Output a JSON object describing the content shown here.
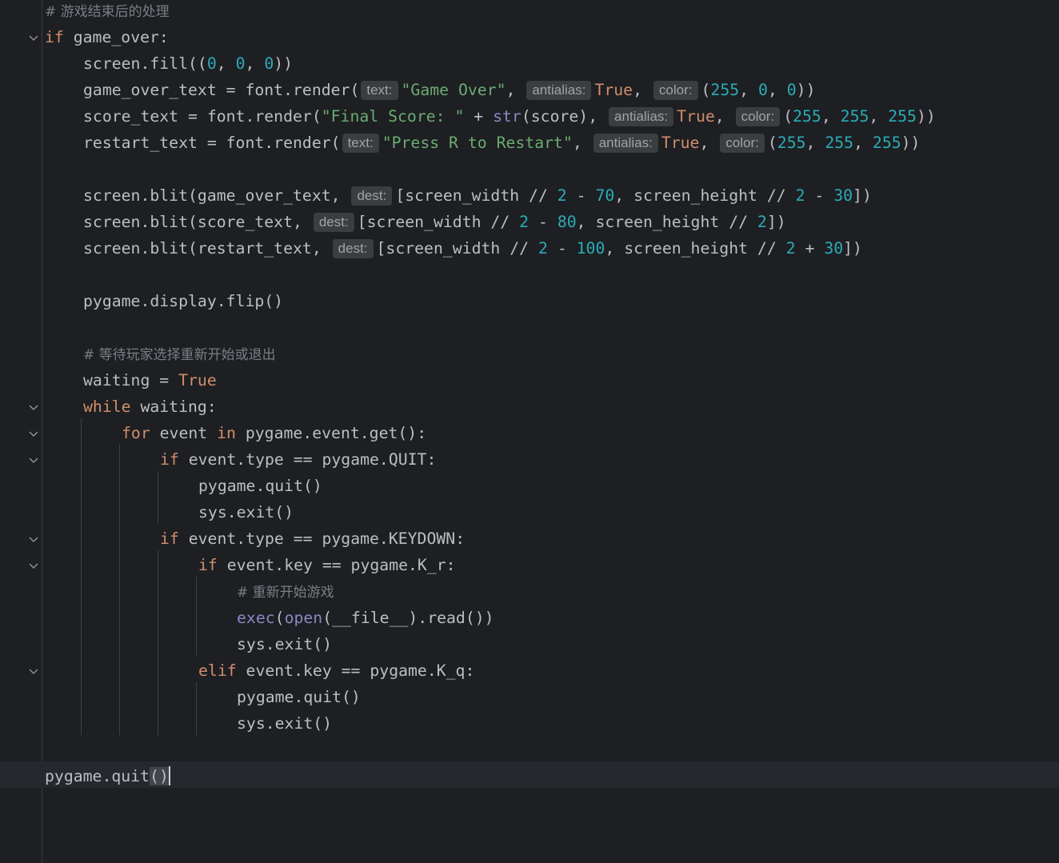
{
  "editor": {
    "theme_colors": {
      "background": "#1e1f22",
      "keyword": "#cf8e6d",
      "string": "#6aab73",
      "number": "#2aacb8",
      "builtin": "#8888c6",
      "comment": "#7a7e85",
      "plain": "#bcbec4"
    },
    "fold_icon": "chevron-down-icon",
    "lines": {
      "l1": {
        "comment": "# 游戏结束后的处理"
      },
      "l2": {
        "kw_if": "if",
        "rest": " game_over:"
      },
      "l3": {
        "a": "screen.fill((",
        "n1": "0",
        "c1": ", ",
        "n2": "0",
        "c2": ", ",
        "n3": "0",
        "end": "))"
      },
      "l4": {
        "a": "game_over_text = font.render(",
        "hint_text": "text:",
        "str": "\"Game Over\"",
        "c1": ", ",
        "hint_antialias": "antialias:",
        "true": "True",
        "c2": ", ",
        "hint_color": "color:",
        "p": "(",
        "n1": "255",
        "c3": ", ",
        "n2": "0",
        "c4": ", ",
        "n3": "0",
        "end": "))"
      },
      "l5": {
        "a": "score_text = font.render(",
        "str": "\"Final Score: \"",
        "b": " + ",
        "builtin": "str",
        "c": "(score), ",
        "hint_antialias": "antialias:",
        "true": "True",
        "c2": ", ",
        "hint_color": "color:",
        "p": "(",
        "n1": "255",
        "c3": ", ",
        "n2": "255",
        "c4": ", ",
        "n3": "255",
        "end": "))"
      },
      "l6": {
        "a": "restart_text = font.render(",
        "hint_text": "text:",
        "str": "\"Press R to Restart\"",
        "c1": ", ",
        "hint_antialias": "antialias:",
        "true": "True",
        "c2": ", ",
        "hint_color": "color:",
        "p": "(",
        "n1": "255",
        "c3": ", ",
        "n2": "255",
        "c4": ", ",
        "n3": "255",
        "end": "))"
      },
      "l8": {
        "a": "screen.blit(game_over_text, ",
        "hint_dest": "dest:",
        "b": "[screen_width // ",
        "n1": "2",
        "c": " - ",
        "n2": "70",
        "d": ", screen_height // ",
        "n3": "2",
        "e": " - ",
        "n4": "30",
        "end": "])"
      },
      "l9": {
        "a": "screen.blit(score_text, ",
        "hint_dest": "dest:",
        "b": "[screen_width // ",
        "n1": "2",
        "c": " - ",
        "n2": "80",
        "d": ", screen_height // ",
        "n3": "2",
        "end": "])"
      },
      "l10": {
        "a": "screen.blit(restart_text, ",
        "hint_dest": "dest:",
        "b": "[screen_width // ",
        "n1": "2",
        "c": " - ",
        "n2": "100",
        "d": ", screen_height // ",
        "n3": "2",
        "e": " + ",
        "n4": "30",
        "end": "])"
      },
      "l12": {
        "text": "pygame.display.flip()"
      },
      "l14": {
        "comment": "# 等待玩家选择重新开始或退出"
      },
      "l15": {
        "a": "waiting = ",
        "true": "True"
      },
      "l16": {
        "kw": "while",
        "rest": " waiting:"
      },
      "l17": {
        "kw_for": "for",
        "a": " event ",
        "kw_in": "in",
        "b": " pygame.event.get():"
      },
      "l18": {
        "kw": "if",
        "rest": " event.type == pygame.QUIT:"
      },
      "l19": {
        "text": "pygame.quit()"
      },
      "l20": {
        "text": "sys.exit()"
      },
      "l21": {
        "kw": "if",
        "rest": " event.type == pygame.KEYDOWN:"
      },
      "l22": {
        "kw": "if",
        "rest": " event.key == pygame.K_r:"
      },
      "l23": {
        "comment": "# 重新开始游戏"
      },
      "l24": {
        "b1": "exec",
        "p1": "(",
        "b2": "open",
        "rest": "(__file__).read())"
      },
      "l25": {
        "text": "sys.exit()"
      },
      "l26": {
        "kw": "elif",
        "rest": " event.key == pygame.K_q:"
      },
      "l27": {
        "text": "pygame.quit()"
      },
      "l28": {
        "text": "sys.exit()"
      },
      "l30": {
        "a": "pygame.quit",
        "paren_open": "(",
        "paren_close": ")"
      }
    }
  }
}
